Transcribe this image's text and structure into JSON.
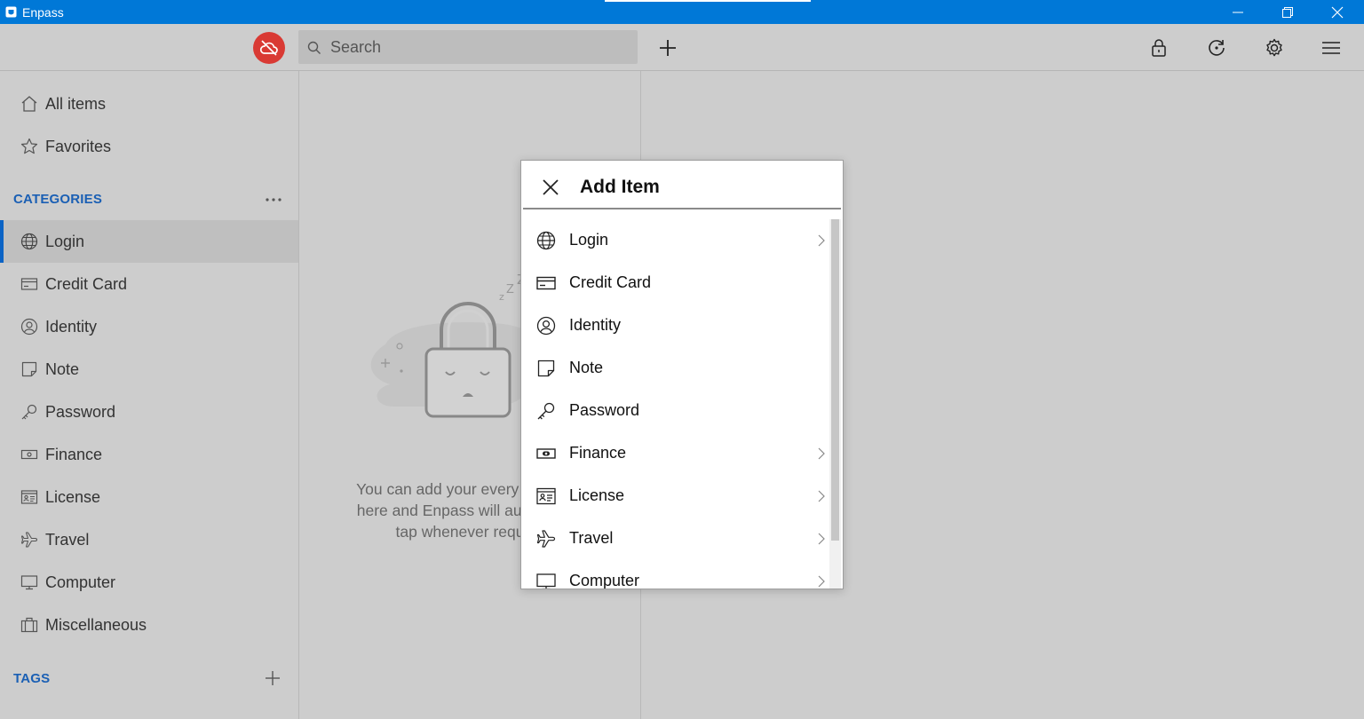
{
  "window": {
    "title": "Enpass",
    "minimize_label": "minimize",
    "maximize_label": "restore",
    "close_label": "close"
  },
  "toolbar": {
    "search_placeholder": "Search",
    "icons": [
      "cloud-off-icon",
      "search-icon",
      "plus-icon",
      "lock-icon",
      "refresh-icon",
      "gear-icon",
      "hamburger-menu-icon"
    ],
    "sync_error_color": "#d93a34"
  },
  "sidebar": {
    "all_items": "All items",
    "favorites": "Favorites",
    "categories_header": "CATEGORIES",
    "categories": [
      {
        "label": "Login",
        "icon": "globe-icon",
        "active": true
      },
      {
        "label": "Credit Card",
        "icon": "credit-card-icon"
      },
      {
        "label": "Identity",
        "icon": "identity-icon"
      },
      {
        "label": "Note",
        "icon": "note-icon"
      },
      {
        "label": "Password",
        "icon": "key-icon"
      },
      {
        "label": "Finance",
        "icon": "banknote-icon"
      },
      {
        "label": "License",
        "icon": "license-icon"
      },
      {
        "label": "Travel",
        "icon": "airplane-icon"
      },
      {
        "label": "Computer",
        "icon": "monitor-icon"
      },
      {
        "label": "Miscellaneous",
        "icon": "briefcase-icon"
      }
    ],
    "tags_header": "TAGS",
    "accent_color": "#0b63c5"
  },
  "middle": {
    "empty_lines": [
      "You can add your every single",
      "here and Enpass will auto-fill t",
      "tap whenever requ"
    ],
    "illustration": "sleeping-lock-icon"
  },
  "dialog": {
    "title": "Add Item",
    "items": [
      {
        "label": "Login",
        "icon": "globe-icon",
        "has_submenu": true
      },
      {
        "label": "Credit Card",
        "icon": "credit-card-icon",
        "has_submenu": false
      },
      {
        "label": "Identity",
        "icon": "identity-icon",
        "has_submenu": false
      },
      {
        "label": "Note",
        "icon": "note-icon",
        "has_submenu": false
      },
      {
        "label": "Password",
        "icon": "key-icon",
        "has_submenu": false
      },
      {
        "label": "Finance",
        "icon": "banknote-icon",
        "has_submenu": true
      },
      {
        "label": "License",
        "icon": "license-icon",
        "has_submenu": true
      },
      {
        "label": "Travel",
        "icon": "airplane-icon",
        "has_submenu": true
      },
      {
        "label": "Computer",
        "icon": "monitor-icon",
        "has_submenu": true
      }
    ]
  }
}
